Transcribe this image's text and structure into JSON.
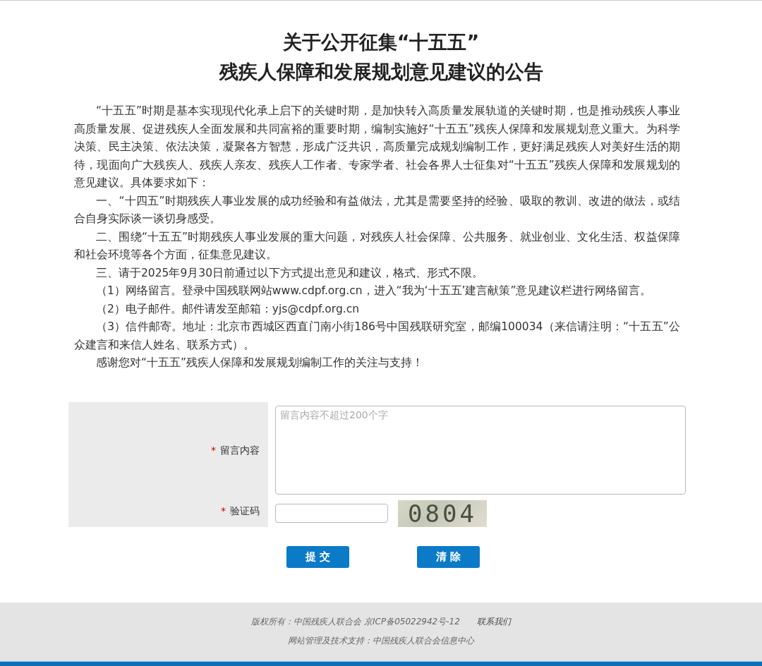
{
  "title": [
    "关于公开征集“十五五”",
    "残疾人保障和发展规划意见建议的公告"
  ],
  "paragraphs": [
    "“十五五”时期是基本实现现代化承上启下的关键时期，是加快转入高质量发展轨道的关键时期，也是推动残疾人事业高质量发展、促进残疾人全面发展和共同富裕的重要时期，编制实施好“十五五”残疾人保障和发展规划意义重大。为科学决策、民主决策、依法决策，凝聚各方智慧，形成广泛共识，高质量完成规划编制工作，更好满足残疾人对美好生活的期待，现面向广大残疾人、残疾人亲友、残疾人工作者、专家学者、社会各界人士征集对“十五五”残疾人保障和发展规划的意见建议。具体要求如下：",
    "一、“十四五”时期残疾人事业发展的成功经验和有益做法，尤其是需要坚持的经验、吸取的教训、改进的做法，或结合自身实际谈一谈切身感受。",
    "二、围绕“十五五”时期残疾人事业发展的重大问题，对残疾人社会保障、公共服务、就业创业、文化生活、权益保障和社会环境等各个方面，征集意见建议。",
    "三、请于2025年9月30日前通过以下方式提出意见和建议，格式、形式不限。",
    "（1）网络留言。登录中国残联网站www.cdpf.org.cn，进入“我为‘十五五’建言献策”意见建议栏进行网络留言。",
    "（2）电子邮件。邮件请发至邮箱：yjs@cdpf.org.cn",
    "（3）信件邮寄。地址：北京市西城区西直门南小街186号中国残联研究室，邮编100034（来信请注明：“十五五”公众建言和来信人姓名、联系方式）。",
    "感谢您对“十五五”残疾人保障和发展规划编制工作的关注与支持！"
  ],
  "form": {
    "message": {
      "required_mark": "*",
      "label": "留言内容",
      "placeholder": "留言内容不超过200个字"
    },
    "captcha": {
      "required_mark": "*",
      "label": "验证码",
      "code": "0804"
    },
    "buttons": [
      "提 交",
      "清 除"
    ]
  },
  "footer": {
    "copyright": "版权所有：中国残疾人联合会 京ICP备05022942号-12",
    "contact": "联系我们",
    "support": "网站管理及技术支持：中国残疾人联合会信息中心"
  }
}
